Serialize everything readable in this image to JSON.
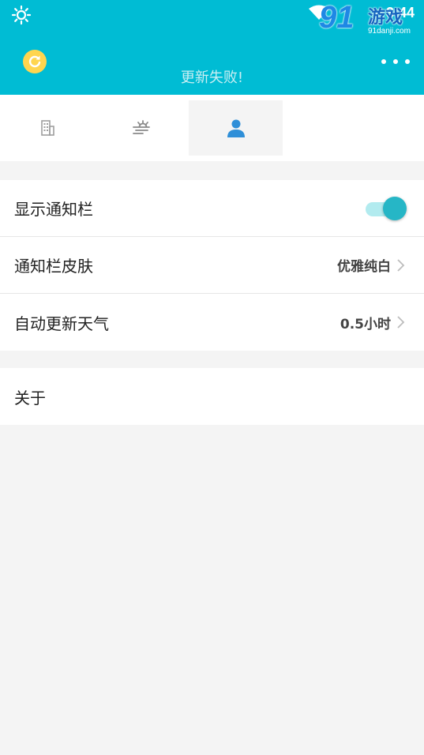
{
  "status_bar": {
    "time": "3:44",
    "weather_icon": "sun-icon",
    "wifi_icon": "wifi-icon"
  },
  "watermark": {
    "logo_number": "91",
    "logo_text": "游戏",
    "url": "91danji.com"
  },
  "header": {
    "update_status": "更新失败!",
    "refresh_icon": "refresh-icon",
    "more_icon": "more-dots-icon",
    "background_color": "#00bcd4"
  },
  "tabs": [
    {
      "icon": "building-icon",
      "active": false
    },
    {
      "icon": "sun-haze-icon",
      "active": false
    },
    {
      "icon": "person-icon",
      "active": true
    }
  ],
  "settings": {
    "show_notification": {
      "label": "显示通知栏",
      "enabled": true
    },
    "notification_skin": {
      "label": "通知栏皮肤",
      "value": "优雅纯白"
    },
    "auto_update": {
      "label": "自动更新天气",
      "value": "0.5小时"
    },
    "about": {
      "label": "关于"
    }
  },
  "colors": {
    "accent": "#26b6c6",
    "active_tab_icon": "#2f8fd8",
    "refresh_button": "#ffd54f"
  }
}
